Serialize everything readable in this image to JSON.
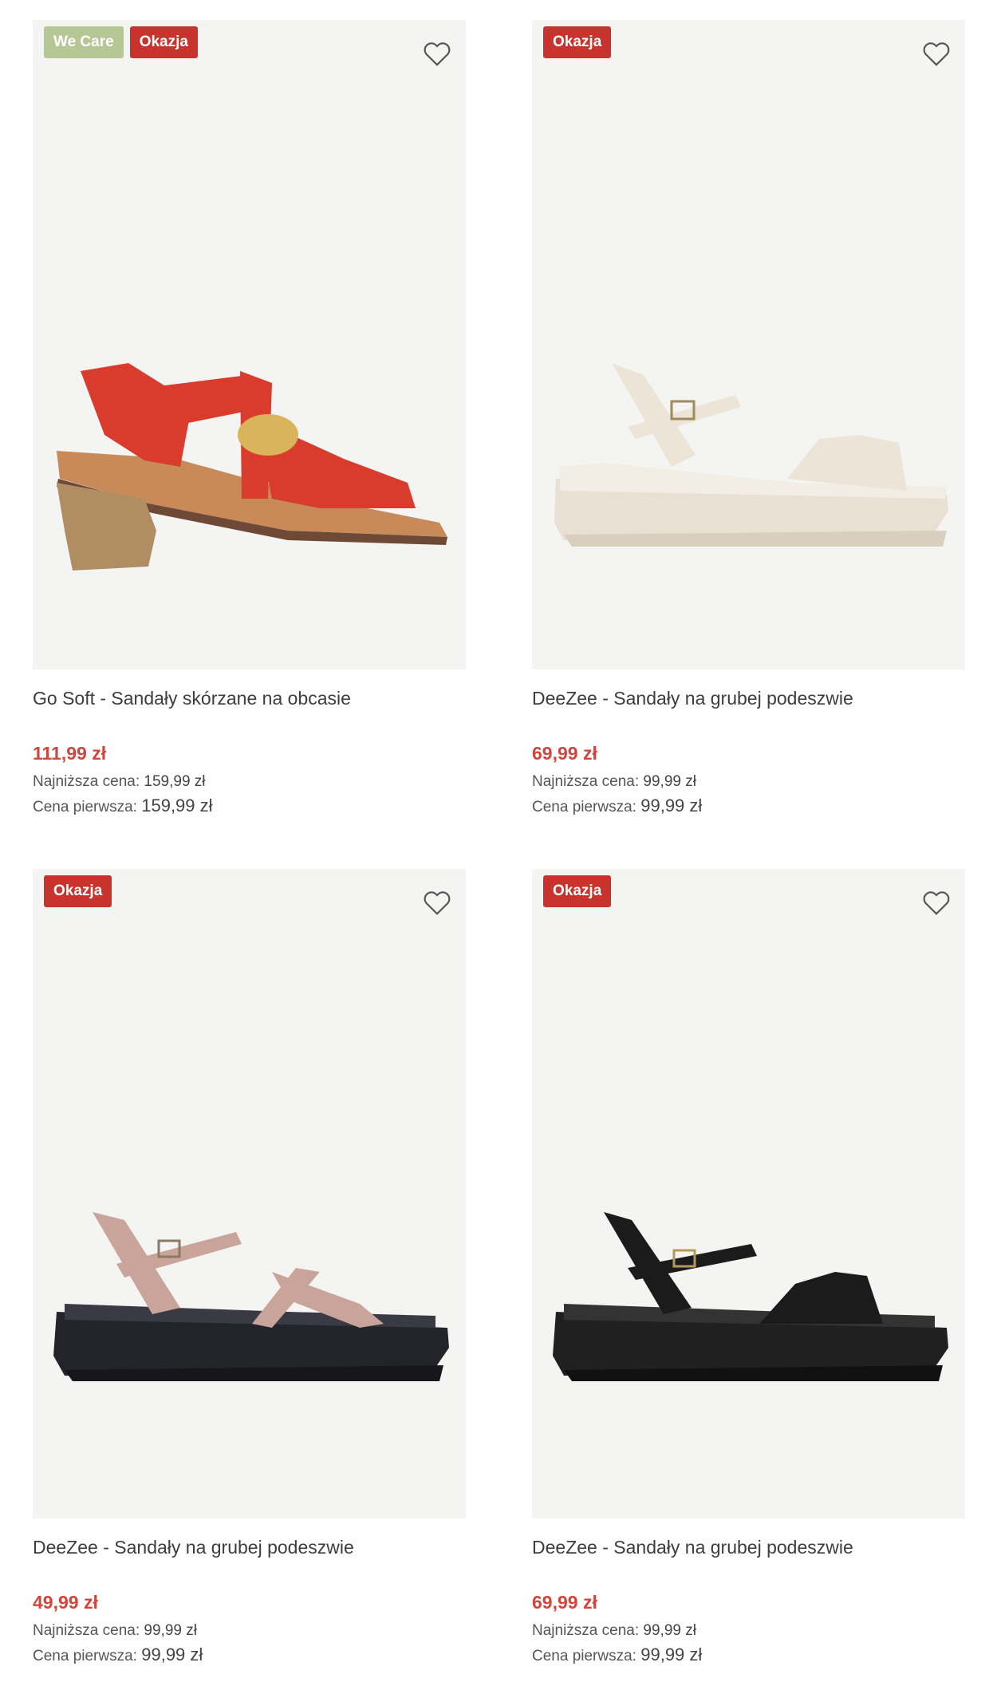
{
  "products": [
    {
      "badges": [
        "We Care",
        "Okazja"
      ],
      "title": "Go Soft - Sandały skórzane na obcasie",
      "price": "111,99 zł",
      "lowest_label": "Najniższa cena:",
      "lowest_value": "159,99 zł",
      "first_label": "Cena pierwsza:",
      "first_value": "159,99 zł",
      "colors": {
        "upper": "#d93c2c",
        "sole": "#c98a5a",
        "heel": "#b08d63"
      }
    },
    {
      "badges": [
        "Okazja"
      ],
      "title": "DeeZee - Sandały na grubej podeszwie",
      "price": "69,99 zł",
      "lowest_label": "Najniższa cena:",
      "lowest_value": "99,99 zł",
      "first_label": "Cena pierwsza:",
      "first_value": "99,99 zł",
      "colors": {
        "upper": "#ece4d6",
        "sole": "#e8e0d2"
      }
    },
    {
      "badges": [
        "Okazja"
      ],
      "title": "DeeZee - Sandały na grubej podeszwie",
      "price": "49,99 zł",
      "lowest_label": "Najniższa cena:",
      "lowest_value": "99,99 zł",
      "first_label": "Cena pierwsza:",
      "first_value": "99,99 zł",
      "colors": {
        "upper": "#c9a49b",
        "sole": "#23232a"
      }
    },
    {
      "badges": [
        "Okazja"
      ],
      "title": "DeeZee - Sandały na grubej podeszwie",
      "price": "69,99 zł",
      "lowest_label": "Najniższa cena:",
      "lowest_value": "99,99 zł",
      "first_label": "Cena pierwsza:",
      "first_value": "99,99 zł",
      "colors": {
        "upper": "#1b1b1b",
        "sole": "#202020"
      }
    }
  ],
  "icons": {
    "favorite": "heart-outline-icon"
  },
  "theme": {
    "sale_price": "#d0463f",
    "badge_deal": "#c8332d",
    "badge_care": "#b6c796"
  }
}
